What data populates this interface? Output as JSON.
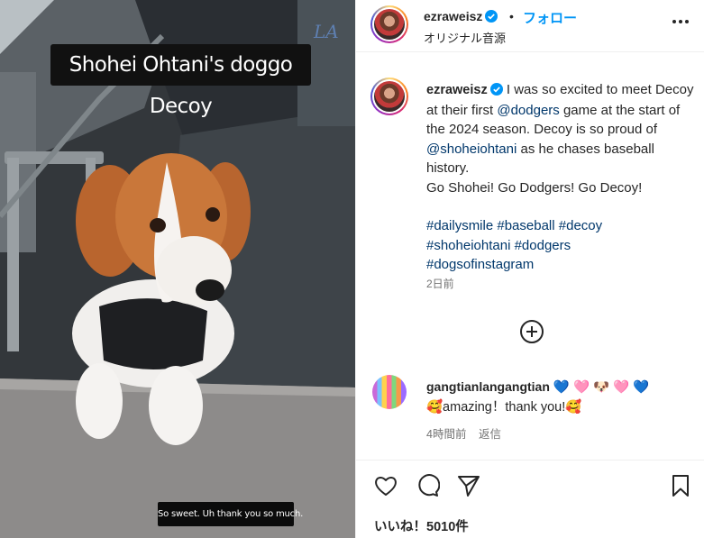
{
  "video": {
    "overlay_title": "Shohei Ohtani's doggo Decoy",
    "subtitle": "So sweet. Uh thank you so much."
  },
  "post_header": {
    "username": "ezraweisz",
    "separator": "•",
    "follow_label": "フォロー",
    "audio_label": "オリジナル音源",
    "more_icon": "more-horizontal-icon"
  },
  "caption": {
    "username": "ezraweisz",
    "part1": " I was so excited to meet Decoy at their first ",
    "mention_dodgers": "@dodgers",
    "part2": " game at the start of the 2024 season. Decoy is so proud of ",
    "mention_ohtani": "@shoheiohtani",
    "part3": " as he chases baseball history.",
    "line2": "Go Shohei! Go Dodgers! Go Decoy!",
    "tags": [
      "#dailysmile",
      "#baseball",
      "#decoy",
      "#shoheiohtani",
      "#dodgers",
      "#dogsofinstagram"
    ],
    "time": "2日前"
  },
  "comment": {
    "username": "gangtianlangangtian",
    "emoji_line1": "💙 🩷 🐶 🩷 💙",
    "text": "🥰amazing！thank you!🥰",
    "time": "4時間前",
    "reply_label": "返信"
  },
  "actions": {
    "likes_label": "いいね！5010件"
  },
  "colors": {
    "accent_blue": "#0095f6",
    "link_blue": "#00376b",
    "muted": "#737373"
  }
}
